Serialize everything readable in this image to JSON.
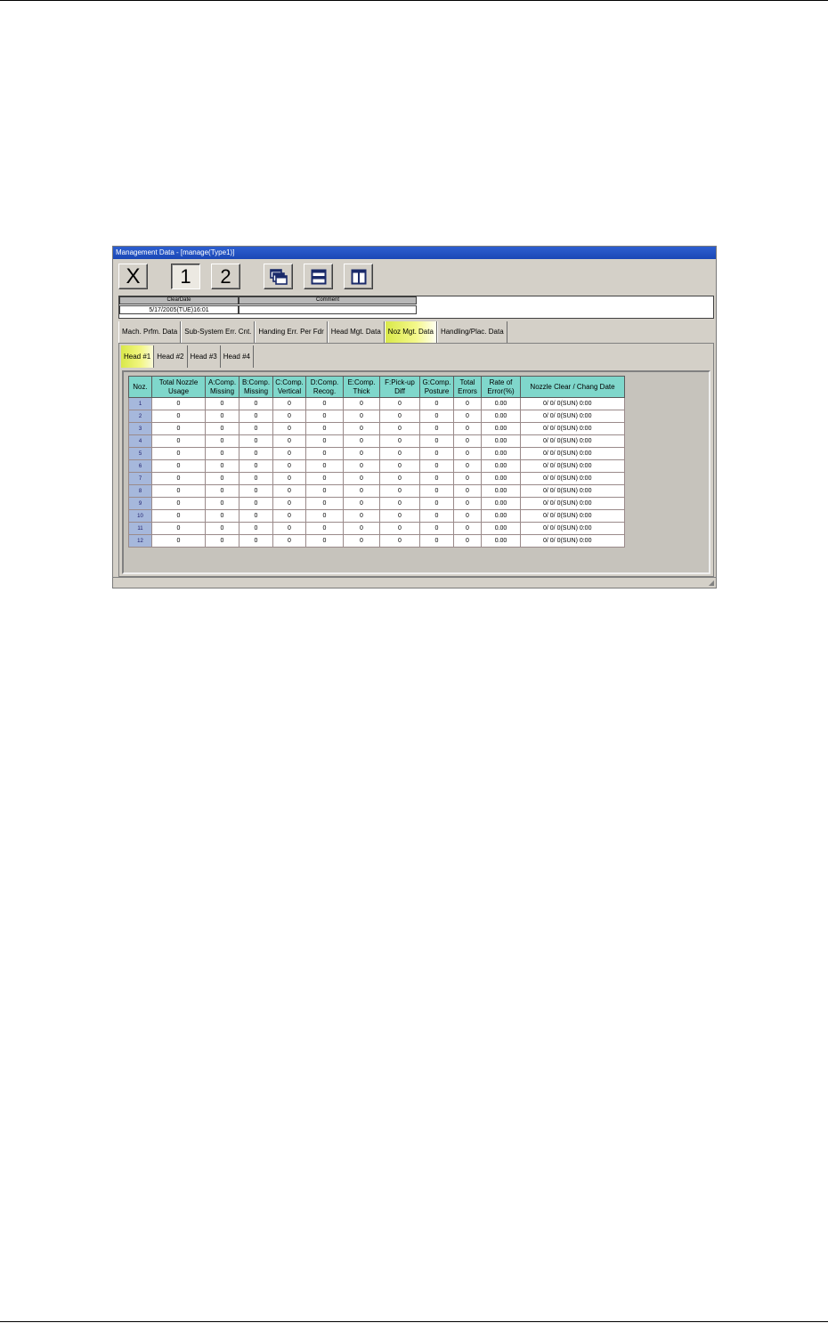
{
  "window": {
    "title": "Management Data - [manage(Type1)]"
  },
  "toolbar": {
    "close_label": "X",
    "page1_label": "1",
    "page2_label": "2"
  },
  "info": {
    "clear_date_header": "ClearDate",
    "clear_date_value": "5/17/2005(TUE)16:01",
    "comment_header": "Comment",
    "comment_value": ""
  },
  "tabs": [
    {
      "label": "Mach. Prfm. Data"
    },
    {
      "label": "Sub-System Err. Cnt."
    },
    {
      "label": "Handing Err. Per Fdr"
    },
    {
      "label": "Head Mgt. Data"
    },
    {
      "label": "Noz Mgt. Data",
      "active": true
    },
    {
      "label": "Handling/Plac. Data"
    }
  ],
  "head_tabs": [
    {
      "label": "Head #1",
      "active": true
    },
    {
      "label": "Head #2"
    },
    {
      "label": "Head #3"
    },
    {
      "label": "Head #4"
    }
  ],
  "table": {
    "columns": [
      [
        "Noz."
      ],
      [
        "Total Nozzle",
        "Usage"
      ],
      [
        "A:Comp.",
        "Missing"
      ],
      [
        "B:Comp.",
        "Missing"
      ],
      [
        "C:Comp.",
        "Vertical"
      ],
      [
        "D:Comp.",
        "Recog."
      ],
      [
        "E:Comp.",
        "Thick"
      ],
      [
        "F:Pick-up",
        "Diff"
      ],
      [
        "G:Comp.",
        "Posture"
      ],
      [
        "Total",
        "Errors"
      ],
      [
        "Rate of",
        "Error(%)"
      ],
      [
        "Nozzle Clear / Chang Date"
      ]
    ],
    "rows": [
      [
        "1",
        "0",
        "0",
        "0",
        "0",
        "0",
        "0",
        "0",
        "0",
        "0",
        "0.00",
        "0/ 0/   0(SUN) 0:00"
      ],
      [
        "2",
        "0",
        "0",
        "0",
        "0",
        "0",
        "0",
        "0",
        "0",
        "0",
        "0.00",
        "0/ 0/   0(SUN) 0:00"
      ],
      [
        "3",
        "0",
        "0",
        "0",
        "0",
        "0",
        "0",
        "0",
        "0",
        "0",
        "0.00",
        "0/ 0/   0(SUN) 0:00"
      ],
      [
        "4",
        "0",
        "0",
        "0",
        "0",
        "0",
        "0",
        "0",
        "0",
        "0",
        "0.00",
        "0/ 0/   0(SUN) 0:00"
      ],
      [
        "5",
        "0",
        "0",
        "0",
        "0",
        "0",
        "0",
        "0",
        "0",
        "0",
        "0.00",
        "0/ 0/   0(SUN) 0:00"
      ],
      [
        "6",
        "0",
        "0",
        "0",
        "0",
        "0",
        "0",
        "0",
        "0",
        "0",
        "0.00",
        "0/ 0/   0(SUN) 0:00"
      ],
      [
        "7",
        "0",
        "0",
        "0",
        "0",
        "0",
        "0",
        "0",
        "0",
        "0",
        "0.00",
        "0/ 0/   0(SUN) 0:00"
      ],
      [
        "8",
        "0",
        "0",
        "0",
        "0",
        "0",
        "0",
        "0",
        "0",
        "0",
        "0.00",
        "0/ 0/   0(SUN) 0:00"
      ],
      [
        "9",
        "0",
        "0",
        "0",
        "0",
        "0",
        "0",
        "0",
        "0",
        "0",
        "0.00",
        "0/ 0/   0(SUN) 0:00"
      ],
      [
        "10",
        "0",
        "0",
        "0",
        "0",
        "0",
        "0",
        "0",
        "0",
        "0",
        "0.00",
        "0/ 0/   0(SUN) 0:00"
      ],
      [
        "11",
        "0",
        "0",
        "0",
        "0",
        "0",
        "0",
        "0",
        "0",
        "0",
        "0.00",
        "0/ 0/   0(SUN) 0:00"
      ],
      [
        "12",
        "0",
        "0",
        "0",
        "0",
        "0",
        "0",
        "0",
        "0",
        "0",
        "0.00",
        "0/ 0/   0(SUN) 0:00"
      ]
    ]
  },
  "colors": {
    "header_cell": "#7fd7cb",
    "row_number_cell": "#a6b8dc",
    "active_tab": "#f4f88a",
    "window_face": "#d4d0c8"
  }
}
